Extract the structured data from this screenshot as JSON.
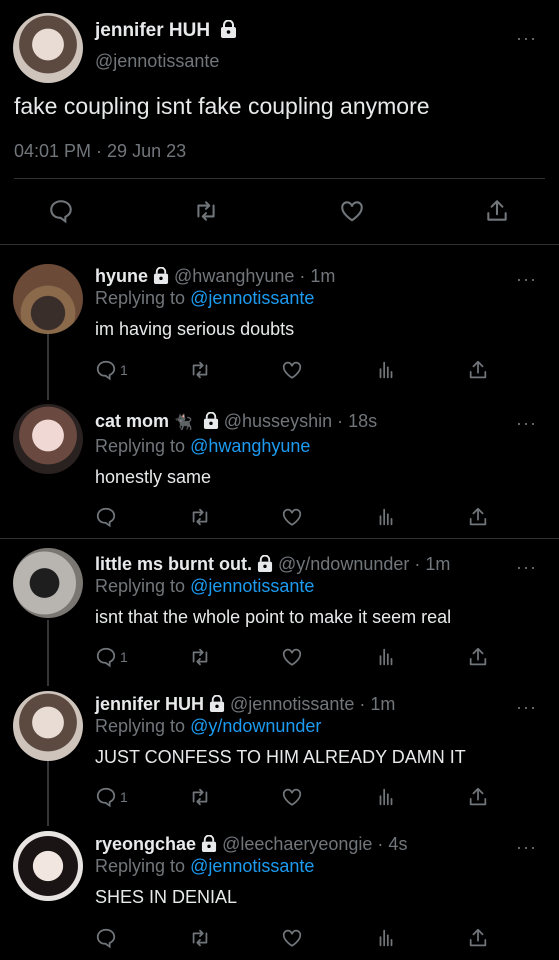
{
  "main_tweet": {
    "name": "jennifer HUH",
    "handle": "@jennotissante",
    "text": "fake coupling isnt fake coupling anymore",
    "timestamp": "04:01 PM · 29 Jun 23",
    "more": "···"
  },
  "replies": [
    {
      "name": "hyune",
      "handle": "@hwanghyune · 1m",
      "replying_prefix": "Replying to ",
      "replying_to": "@jennotissante",
      "text": "im having serious doubts",
      "reply_count": "1",
      "emoji": ""
    },
    {
      "name": "cat mom",
      "handle": "@husseyshin · 18s",
      "replying_prefix": "Replying to ",
      "replying_to": "@hwanghyune",
      "text": "honestly same",
      "reply_count": "",
      "emoji": "🐈‍⬛"
    },
    {
      "name": "little ms burnt out.",
      "handle": "@y/ndownunder · 1m",
      "replying_prefix": "Replying to ",
      "replying_to": "@jennotissante",
      "text": "isnt that the whole point to make it seem real",
      "reply_count": "1",
      "emoji": ""
    },
    {
      "name": "jennifer HUH",
      "handle": "@jennotissante · 1m",
      "replying_prefix": "Replying to ",
      "replying_to": "@y/ndownunder",
      "text": "JUST CONFESS TO HIM ALREADY DAMN IT",
      "reply_count": "1",
      "emoji": ""
    },
    {
      "name": "ryeongchae",
      "handle": "@leechaeryeongie · 4s",
      "replying_prefix": "Replying to ",
      "replying_to": "@jennotissante",
      "text": "SHES IN DENIAL",
      "reply_count": "",
      "emoji": ""
    }
  ],
  "icons": [
    "lock-icon",
    "more-icon",
    "reply-icon",
    "retweet-icon",
    "like-icon",
    "share-icon",
    "analytics-icon"
  ],
  "colors": {
    "background": "#000000",
    "text": "#e7e9ea",
    "muted": "#71767b",
    "link": "#1d9bf0"
  }
}
